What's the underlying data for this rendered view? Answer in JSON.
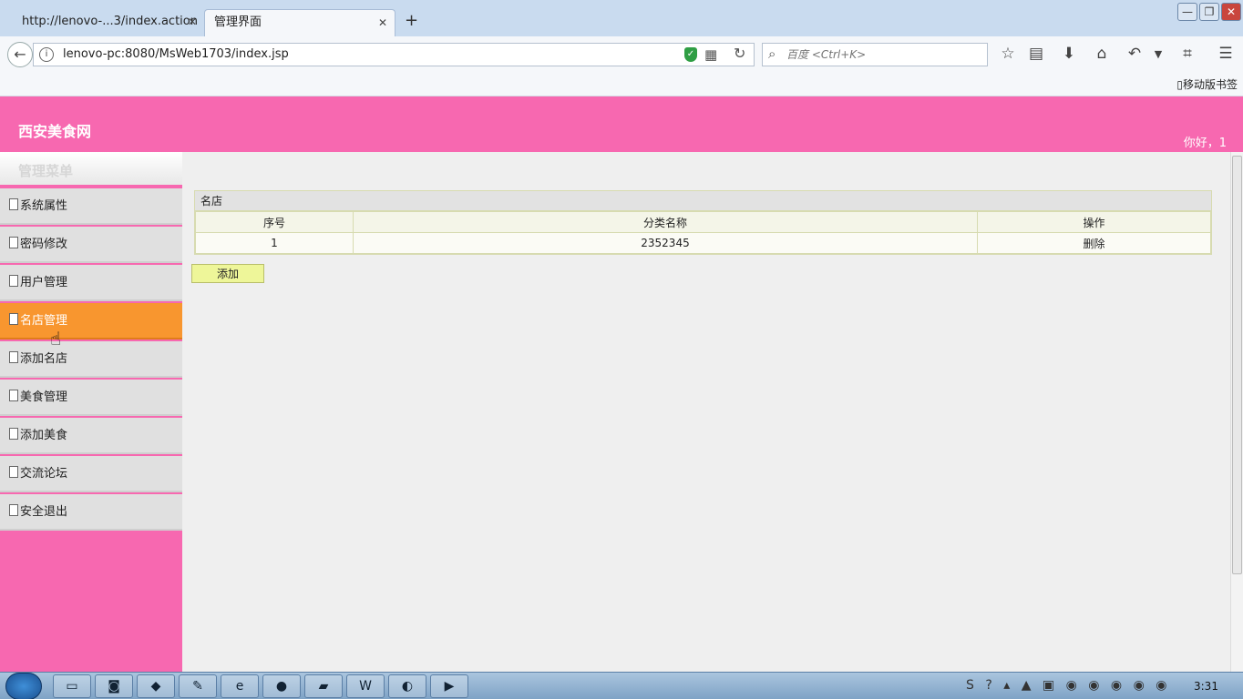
{
  "browser": {
    "tabs": [
      {
        "label": "http://lenovo-...3/index.action",
        "close": "✕"
      },
      {
        "label": "管理界面",
        "close": "✕"
      }
    ],
    "new_tab": "+",
    "url": "lenovo-pc:8080/MsWeb1703/index.jsp",
    "search_placeholder": "百度 <Ctrl+K>",
    "mobile_bookmarks": "移动版书签",
    "window_buttons": {
      "minimize": "—",
      "maximize": "❐",
      "close": "✕"
    }
  },
  "header": {
    "site_title": "西安美食网",
    "greeting": "你好，1"
  },
  "sidebar": {
    "title": "管理菜单",
    "items": [
      {
        "label": "系统属性"
      },
      {
        "label": "密码修改"
      },
      {
        "label": "用户管理"
      },
      {
        "label": "名店管理"
      },
      {
        "label": "添加名店"
      },
      {
        "label": "美食管理"
      },
      {
        "label": "添加美食"
      },
      {
        "label": "交流论坛"
      },
      {
        "label": "安全退出"
      }
    ],
    "active_item": "名店管理"
  },
  "main": {
    "panel_title": "名店",
    "columns": [
      "序号",
      "分类名称",
      "操作"
    ],
    "rows": [
      {
        "index": "1",
        "name": "2352345",
        "action": "删除"
      }
    ],
    "add_button": "添加"
  },
  "taskbar": {
    "clock": "3:31"
  },
  "colors": {
    "header_pink": "#f768b0",
    "active_orange": "#f8962f",
    "menu_gray": "#e0e0e0"
  }
}
